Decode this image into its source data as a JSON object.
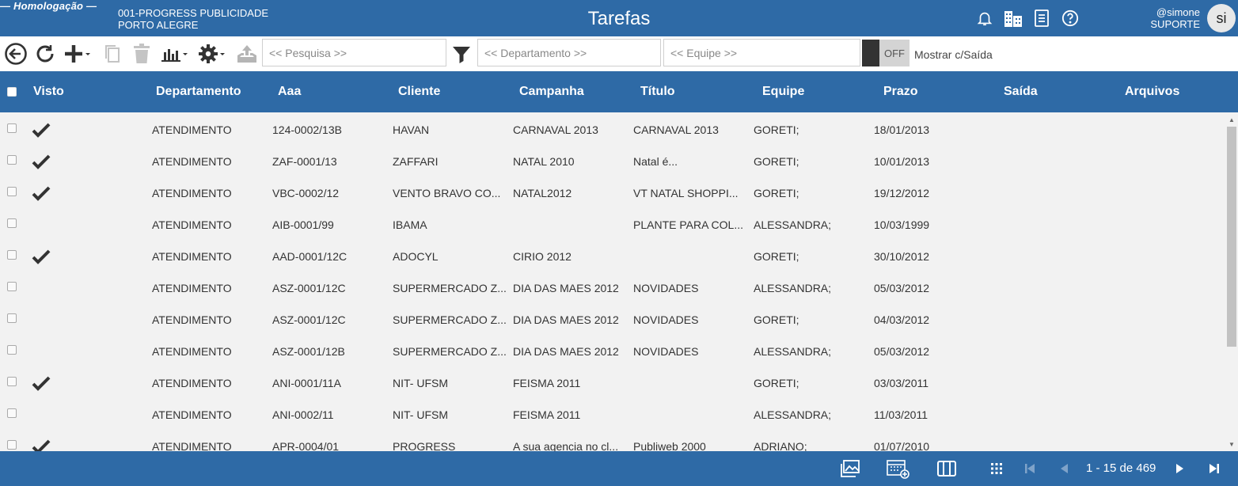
{
  "header": {
    "env_tag": "— Homologação —",
    "company_line1": "001-PROGRESS PUBLICIDADE",
    "company_line2": "PORTO ALEGRE",
    "title": "Tarefas",
    "user_handle": "@simone",
    "user_role": "SUPORTE",
    "avatar_initials": "si",
    "icons": [
      "bell-icon",
      "buildings-icon",
      "document-icon",
      "help-icon"
    ]
  },
  "toolbar": {
    "search_placeholder": "<< Pesquisa >>",
    "department_placeholder": "<< Departamento >>",
    "team_placeholder": "<< Equipe >>",
    "toggle_state": "OFF",
    "toggle_label": "Mostrar c/Saída"
  },
  "columns": [
    "Visto",
    "Departamento",
    "Aaa",
    "Cliente",
    "Campanha",
    "Título",
    "Equipe",
    "Prazo",
    "Saída",
    "Arquivos"
  ],
  "rows": [
    {
      "visto": true,
      "departamento": "ATENDIMENTO",
      "aaa": "124-0002/13B",
      "cliente": "HAVAN",
      "campanha": "CARNAVAL 2013",
      "titulo": "CARNAVAL 2013",
      "equipe": "GORETI;",
      "prazo": "18/01/2013"
    },
    {
      "visto": true,
      "departamento": "ATENDIMENTO",
      "aaa": "ZAF-0001/13",
      "cliente": "ZAFFARI",
      "campanha": "NATAL 2010",
      "titulo": "Natal é...",
      "equipe": "GORETI;",
      "prazo": "10/01/2013"
    },
    {
      "visto": true,
      "departamento": "ATENDIMENTO",
      "aaa": "VBC-0002/12",
      "cliente": "VENTO BRAVO CO...",
      "campanha": "NATAL2012",
      "titulo": "VT NATAL SHOPPI...",
      "equipe": "GORETI;",
      "prazo": "19/12/2012"
    },
    {
      "visto": false,
      "departamento": "ATENDIMENTO",
      "aaa": "AIB-0001/99",
      "cliente": "IBAMA",
      "campanha": "",
      "titulo": "PLANTE PARA COL...",
      "equipe": "ALESSANDRA;",
      "prazo": "10/03/1999"
    },
    {
      "visto": true,
      "departamento": "ATENDIMENTO",
      "aaa": "AAD-0001/12C",
      "cliente": "ADOCYL",
      "campanha": "CIRIO 2012",
      "titulo": "",
      "equipe": "GORETI;",
      "prazo": "30/10/2012"
    },
    {
      "visto": false,
      "departamento": "ATENDIMENTO",
      "aaa": "ASZ-0001/12C",
      "cliente": "SUPERMERCADO Z...",
      "campanha": "DIA DAS MAES 2012",
      "titulo": "NOVIDADES",
      "equipe": "ALESSANDRA;",
      "prazo": "05/03/2012"
    },
    {
      "visto": false,
      "departamento": "ATENDIMENTO",
      "aaa": "ASZ-0001/12C",
      "cliente": "SUPERMERCADO Z...",
      "campanha": "DIA DAS MAES 2012",
      "titulo": "NOVIDADES",
      "equipe": "GORETI;",
      "prazo": "04/03/2012"
    },
    {
      "visto": false,
      "departamento": "ATENDIMENTO",
      "aaa": "ASZ-0001/12B",
      "cliente": "SUPERMERCADO Z...",
      "campanha": "DIA DAS MAES 2012",
      "titulo": "NOVIDADES",
      "equipe": "ALESSANDRA;",
      "prazo": "05/03/2012"
    },
    {
      "visto": true,
      "departamento": "ATENDIMENTO",
      "aaa": "ANI-0001/11A",
      "cliente": "NIT- UFSM",
      "campanha": "FEISMA 2011",
      "titulo": "",
      "equipe": "GORETI;",
      "prazo": "03/03/2011"
    },
    {
      "visto": false,
      "departamento": "ATENDIMENTO",
      "aaa": "ANI-0002/11",
      "cliente": "NIT- UFSM",
      "campanha": "FEISMA 2011",
      "titulo": "",
      "equipe": "ALESSANDRA;",
      "prazo": "11/03/2011"
    },
    {
      "visto": true,
      "departamento": "ATENDIMENTO",
      "aaa": "APR-0004/01",
      "cliente": "PROGRESS",
      "campanha": "A sua agencia no cl...",
      "titulo": "Publiweb 2000",
      "equipe": "ADRIANO;",
      "prazo": "01/07/2010"
    }
  ],
  "footer": {
    "pager_text": "1 - 15 de 469"
  },
  "colors": {
    "primary": "#2e6aa6",
    "row_bg": "#f2f2f2",
    "text": "#333333"
  }
}
